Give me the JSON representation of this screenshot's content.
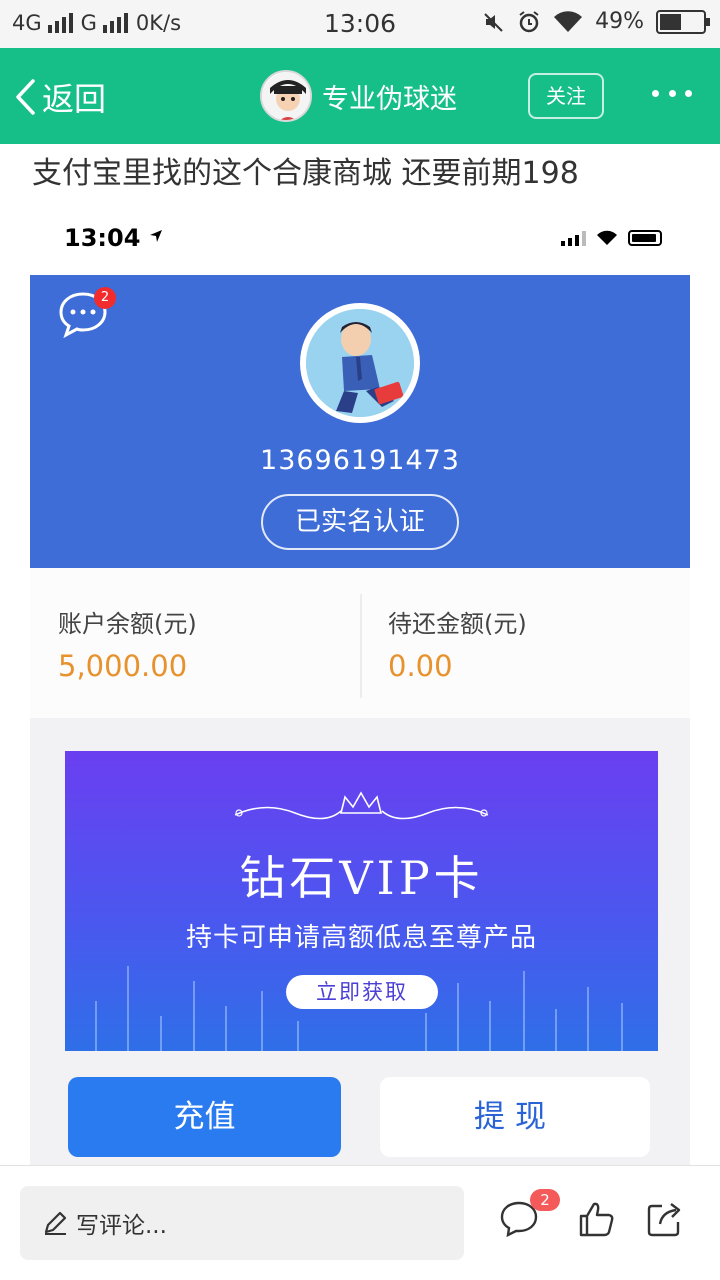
{
  "status_bar": {
    "network_1": "4G",
    "network_2": "G",
    "speed": "0K/s",
    "time": "13:06",
    "battery": "49%",
    "battery_level": 0.49
  },
  "nav": {
    "back_label": "返回",
    "username": "专业伪球迷",
    "follow_label": "关注"
  },
  "post": {
    "text": "支付宝里找的这个合康商城 还要前期198"
  },
  "screenshot": {
    "ios_time": "13:04",
    "chat_badge": "2",
    "phone": "13696191473",
    "verified_label": "已实名认证",
    "balance_label": "账户余额(元)",
    "balance_value": "5,000.00",
    "due_label": "待还金额(元)",
    "due_value": "0.00",
    "vip_title": "钻石VIP卡",
    "vip_subtitle": "持卡可申请高额低息至尊产品",
    "vip_button": "立即获取",
    "recharge_label": "充值",
    "withdraw_label": "提现"
  },
  "bottom": {
    "comment_placeholder": "写评论...",
    "comment_count": "2"
  },
  "colors": {
    "nav_green": "#17bf88",
    "profile_blue": "#3f6dd8",
    "balance_orange": "#e8922e",
    "recharge_blue": "#2a7bef"
  },
  "icons": [
    "back-icon",
    "avatar",
    "more-icon",
    "chat-icon",
    "pencil-icon",
    "comment-icon",
    "like-icon",
    "share-icon"
  ]
}
